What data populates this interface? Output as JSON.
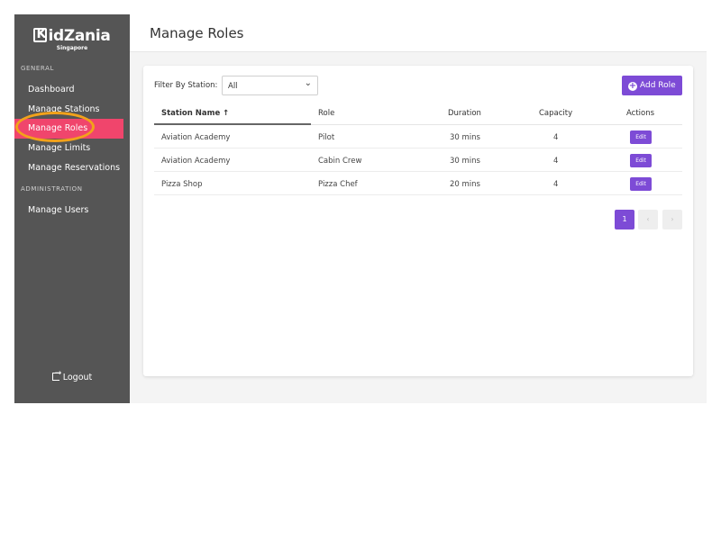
{
  "brand": {
    "name": "idZania",
    "sub": "Singapore"
  },
  "sidebar": {
    "section_general": "GENERAL",
    "section_admin": "ADMINISTRATION",
    "items": [
      {
        "label": "Dashboard"
      },
      {
        "label": "Manage Stations"
      },
      {
        "label": "Manage Roles"
      },
      {
        "label": "Manage Limits"
      },
      {
        "label": "Manage Reservations"
      },
      {
        "label": "Manage Users"
      }
    ],
    "active_item": "Manage Roles",
    "logout": "Logout"
  },
  "header": {
    "title": "Manage Roles"
  },
  "filter": {
    "label": "Filter By Station:",
    "value": "All"
  },
  "add_button": "Add Role",
  "table": {
    "columns": [
      "Station Name ↑",
      "Role",
      "Duration",
      "Capacity",
      "Actions"
    ],
    "rows": [
      {
        "station": "Aviation Academy",
        "role": "Pilot",
        "duration": "30 mins",
        "capacity": "4",
        "action": "Edit"
      },
      {
        "station": "Aviation Academy",
        "role": "Cabin Crew",
        "duration": "30 mins",
        "capacity": "4",
        "action": "Edit"
      },
      {
        "station": "Pizza Shop",
        "role": "Pizza Chef",
        "duration": "20 mins",
        "capacity": "4",
        "action": "Edit"
      }
    ]
  },
  "pagination": {
    "current": "1",
    "prev": "‹",
    "next": "›"
  },
  "colors": {
    "accent": "#7d4bd6",
    "active_nav": "#f0456c",
    "sidebar": "#555555",
    "highlight": "#f2a21a"
  }
}
